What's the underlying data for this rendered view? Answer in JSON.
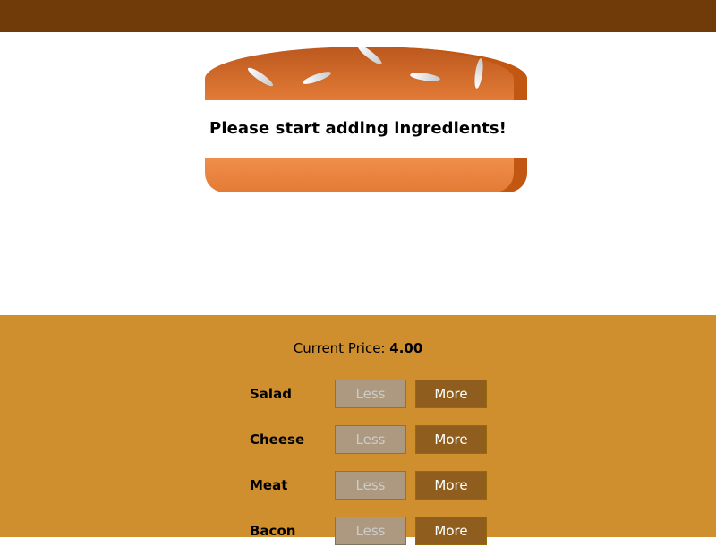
{
  "burger": {
    "message": "Please start adding ingredients!"
  },
  "price": {
    "label": "Current Price:",
    "value": "4.00"
  },
  "ingredients": [
    {
      "label": "Salad",
      "less_label": "Less",
      "more_label": "More"
    },
    {
      "label": "Cheese",
      "less_label": "Less",
      "more_label": "More"
    },
    {
      "label": "Meat",
      "less_label": "Less",
      "more_label": "More"
    },
    {
      "label": "Bacon",
      "less_label": "Less",
      "more_label": "More"
    }
  ],
  "colors": {
    "topbar": "#703B09",
    "controls_bg": "#CF8F2E",
    "less_button": "#AC9980",
    "more_button": "#8F5E1E"
  }
}
